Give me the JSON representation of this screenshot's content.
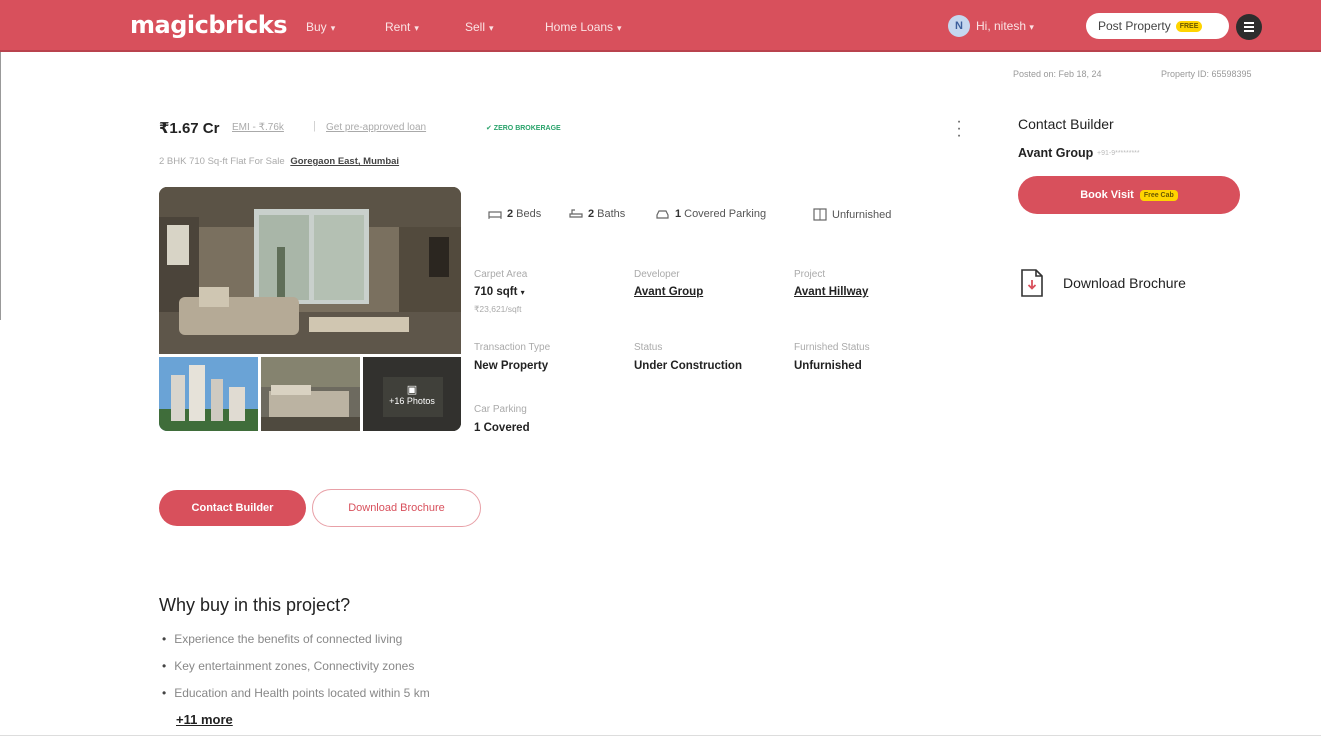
{
  "nav": {
    "logo": "magicbricks",
    "links": [
      "Buy",
      "Rent",
      "Sell",
      "Home Loans"
    ],
    "avatar_initial": "N",
    "user_greeting": "Hi, nitesh",
    "post_property": "Post Property",
    "post_badge": "FREE",
    "brand_color": "#d8505c"
  },
  "meta": {
    "posted_on": "Posted on: Feb 18, 24",
    "property_id": "Property ID: 65598395"
  },
  "listing": {
    "price": "₹1.67 Cr",
    "emi": "EMI - ₹.76k",
    "pre_approved": "Get pre-approved loan",
    "zero_brokerage": "✔ ZERO BROKERAGE",
    "title_prefix": "2 BHK 710 Sq-ft Flat For Sale",
    "location": "Goregaon East, Mumbai",
    "more_photos": "+16 Photos"
  },
  "amenities": [
    {
      "num": "2",
      "label": "Beds",
      "icon": "bed-icon"
    },
    {
      "num": "2",
      "label": "Baths",
      "icon": "bath-icon"
    },
    {
      "num": "1",
      "label": "Covered Parking",
      "icon": "car-icon"
    },
    {
      "num": "",
      "label": "Unfurnished",
      "icon": "wardrobe-icon"
    }
  ],
  "specs": {
    "carpet_area_label": "Carpet Area",
    "carpet_area_value": "710 sqft",
    "carpet_area_rate": "₹23,621/sqft",
    "developer_label": "Developer",
    "developer_value": "Avant Group",
    "project_label": "Project",
    "project_value": "Avant Hillway",
    "transaction_label": "Transaction Type",
    "transaction_value": "New Property",
    "status_label": "Status",
    "status_value": "Under Construction",
    "furnished_label": "Furnished Status",
    "furnished_value": "Unfurnished",
    "parking_label": "Car Parking",
    "parking_value": "1 Covered"
  },
  "actions": {
    "contact_builder": "Contact Builder",
    "download_brochure": "Download Brochure"
  },
  "why_buy": {
    "heading": "Why buy in this project?",
    "points": [
      "Experience the benefits of connected living",
      "Key entertainment zones, Connectivity zones",
      "Education and Health points located within 5 km"
    ],
    "more": "+11 more"
  },
  "sidebar": {
    "title": "Contact Builder",
    "builder_name": "Avant Group",
    "builder_phone": "+91-9*********",
    "book_visit": "Book Visit",
    "free_cab": "Free Cab",
    "download_brochure": "Download Brochure"
  }
}
